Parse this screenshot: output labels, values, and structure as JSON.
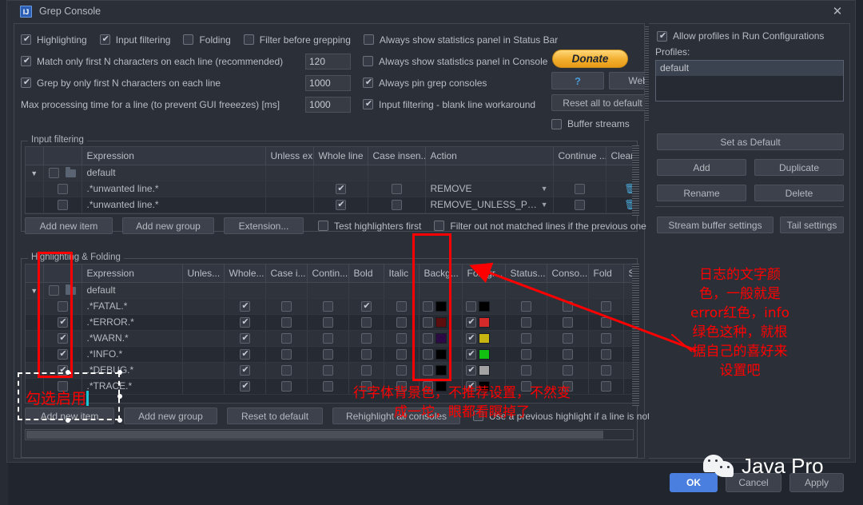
{
  "window": {
    "title": "Grep Console",
    "icon": "intellij-idea-icon",
    "close_label": "✕"
  },
  "top_options": {
    "row1": [
      {
        "label": "Highlighting",
        "checked": true,
        "name": "highlighting"
      },
      {
        "label": "Input filtering",
        "checked": true,
        "name": "input-filtering"
      },
      {
        "label": "Folding",
        "checked": false,
        "name": "folding"
      },
      {
        "label": "Filter before grepping",
        "checked": false,
        "name": "filter-before-grepping"
      }
    ],
    "left_rows": [
      {
        "label": "Match only first N characters on each line (recommended)",
        "checked": true,
        "value": "120",
        "name": "match-first-n-characters"
      },
      {
        "label": "Grep by only first N characters on each line",
        "checked": true,
        "value": "1000",
        "name": "grep-first-n-characters"
      },
      {
        "label": "Max processing time for a line (to prevent GUI freeezes) [ms]",
        "checked": null,
        "value": "1000",
        "name": "max-processing-time"
      }
    ],
    "right_rows": [
      {
        "label": "Always show statistics panel in Status Bar",
        "checked": false,
        "name": "stats-panel-status-bar"
      },
      {
        "label": "Always show statistics panel in Console",
        "checked": false,
        "name": "stats-panel-console"
      },
      {
        "label": "Always pin grep consoles",
        "checked": true,
        "name": "always-pin-grep-consoles"
      },
      {
        "label": "Input filtering - blank line workaround",
        "checked": true,
        "name": "blank-line-workaround"
      }
    ],
    "buttons": {
      "donate": "Donate",
      "help": "?",
      "web_page": "Web pa",
      "reset_all": "Reset all to default",
      "buffer_streams": "Buffer streams",
      "buffer_streams_checked": false
    }
  },
  "input_filtering": {
    "title": "Input filtering",
    "columns": [
      "",
      "",
      "Expression",
      "Unless ex...",
      "Whole line",
      "Case insen...",
      "Action",
      "Continue ...",
      "Clear Cons..."
    ],
    "rows": [
      {
        "type": "group",
        "expand": "▼",
        "checked": false,
        "expression": "default",
        "unless": "",
        "whole_line": null,
        "case_insensitive": null,
        "action": "",
        "continue": null,
        "clear": ""
      },
      {
        "type": "item",
        "checked": false,
        "expression": ".*unwanted line.*",
        "unless": "",
        "whole_line": true,
        "case_insensitive": false,
        "action": "REMOVE",
        "continue": false,
        "clear": "trash-icon"
      },
      {
        "type": "item",
        "checked": false,
        "expression": ".*unwanted line.*",
        "unless": "",
        "whole_line": true,
        "case_insensitive": false,
        "action": "REMOVE_UNLESS_PREVIO...",
        "continue": false,
        "clear": "trash-icon"
      }
    ],
    "buttons": [
      "Add new item",
      "Add new group",
      "Extension..."
    ],
    "checkboxes": [
      {
        "label": "Test highlighters first",
        "checked": false,
        "name": "test-highlighters-first"
      },
      {
        "label": "Filter out not matched lines if the previous one wa",
        "checked": false,
        "name": "filter-out-not-matched"
      }
    ]
  },
  "highlighting": {
    "title": "Highlighting & Folding",
    "columns": [
      "",
      "",
      "Expression",
      "Unles...",
      "Whole...",
      "Case i...",
      "Contin...",
      "Bold",
      "Italic",
      "Backg...",
      "Foregr...",
      "Status...",
      "Conso...",
      "Fold",
      "Sou"
    ],
    "rows": [
      {
        "type": "group",
        "expand": "▼",
        "checked": false,
        "expression": "default"
      },
      {
        "type": "item",
        "checked": false,
        "expression": ".*FATAL.*",
        "whole_line": true,
        "case_i": false,
        "contin": false,
        "bold": true,
        "italic": false,
        "bg_on": false,
        "bg_color": "#000000",
        "fg_on": false,
        "fg_color": "#000000",
        "status": false,
        "console": false,
        "fold": false,
        "sound": "speaker-icon"
      },
      {
        "type": "item",
        "checked": true,
        "expression": ".*ERROR.*",
        "whole_line": true,
        "case_i": false,
        "contin": false,
        "bold": false,
        "italic": false,
        "bg_on": false,
        "bg_color": "#5c0d0d",
        "fg_on": true,
        "fg_color": "#d42a2a",
        "status": false,
        "console": false,
        "fold": false,
        "sound": "speaker-icon"
      },
      {
        "type": "item",
        "checked": true,
        "expression": ".*WARN.*",
        "whole_line": true,
        "case_i": false,
        "contin": false,
        "bold": false,
        "italic": false,
        "bg_on": false,
        "bg_color": "#2c0b45",
        "fg_on": true,
        "fg_color": "#c9b511",
        "status": false,
        "console": false,
        "fold": false,
        "sound": "speaker-icon"
      },
      {
        "type": "item",
        "checked": true,
        "expression": ".*INFO.*",
        "whole_line": true,
        "case_i": false,
        "contin": false,
        "bold": false,
        "italic": false,
        "bg_on": false,
        "bg_color": "#000000",
        "fg_on": true,
        "fg_color": "#11c011",
        "status": false,
        "console": false,
        "fold": false,
        "sound": "speaker-icon"
      },
      {
        "type": "item",
        "checked": true,
        "expression": ".*DEBUG.*",
        "whole_line": true,
        "case_i": false,
        "contin": false,
        "bold": false,
        "italic": false,
        "bg_on": false,
        "bg_color": "#000000",
        "fg_on": true,
        "fg_color": "#a3a3a3",
        "status": false,
        "console": false,
        "fold": false,
        "sound": "speaker-icon"
      },
      {
        "type": "item",
        "checked": false,
        "expression": ".*TRACE.*",
        "whole_line": true,
        "case_i": false,
        "contin": false,
        "bold": false,
        "italic": false,
        "bg_on": false,
        "bg_color": "#000000",
        "fg_on": true,
        "fg_color": "#000000",
        "status": false,
        "console": false,
        "fold": false,
        "sound": "speaker-icon"
      }
    ],
    "buttons": [
      "Add new item",
      "Add new group",
      "Reset to default",
      "Rehighlight all consoles"
    ],
    "checkbox": {
      "label": "Use a previous highlight if a line is not mat",
      "checked": false,
      "name": "use-previous-highlight"
    }
  },
  "profiles": {
    "allow_label": "Allow profiles in Run Configurations",
    "allow_checked": true,
    "list_label": "Profiles:",
    "items": [
      "default"
    ],
    "selected": "default",
    "buttons": {
      "set_default": "Set as Default",
      "add": "Add",
      "duplicate": "Duplicate",
      "rename": "Rename",
      "delete": "Delete",
      "stream_buffer": "Stream buffer settings",
      "tail": "Tail settings"
    }
  },
  "footer": {
    "ok": "OK",
    "cancel": "Cancel",
    "apply": "Apply"
  },
  "watermark": {
    "text": "Java Pro",
    "icon": "wechat-icon"
  },
  "annotations": {
    "left_note": "勾选启用",
    "middle_note_line1": "行字体背景色，不推荐设置，不然变",
    "middle_note_line2": "成一坨，眼都看瞑掉了",
    "right_note": "日志的文字颜色，一般就是error红色，info绿色这种，就根据自己的喜好来设置吧",
    "color": "#ff0000"
  }
}
